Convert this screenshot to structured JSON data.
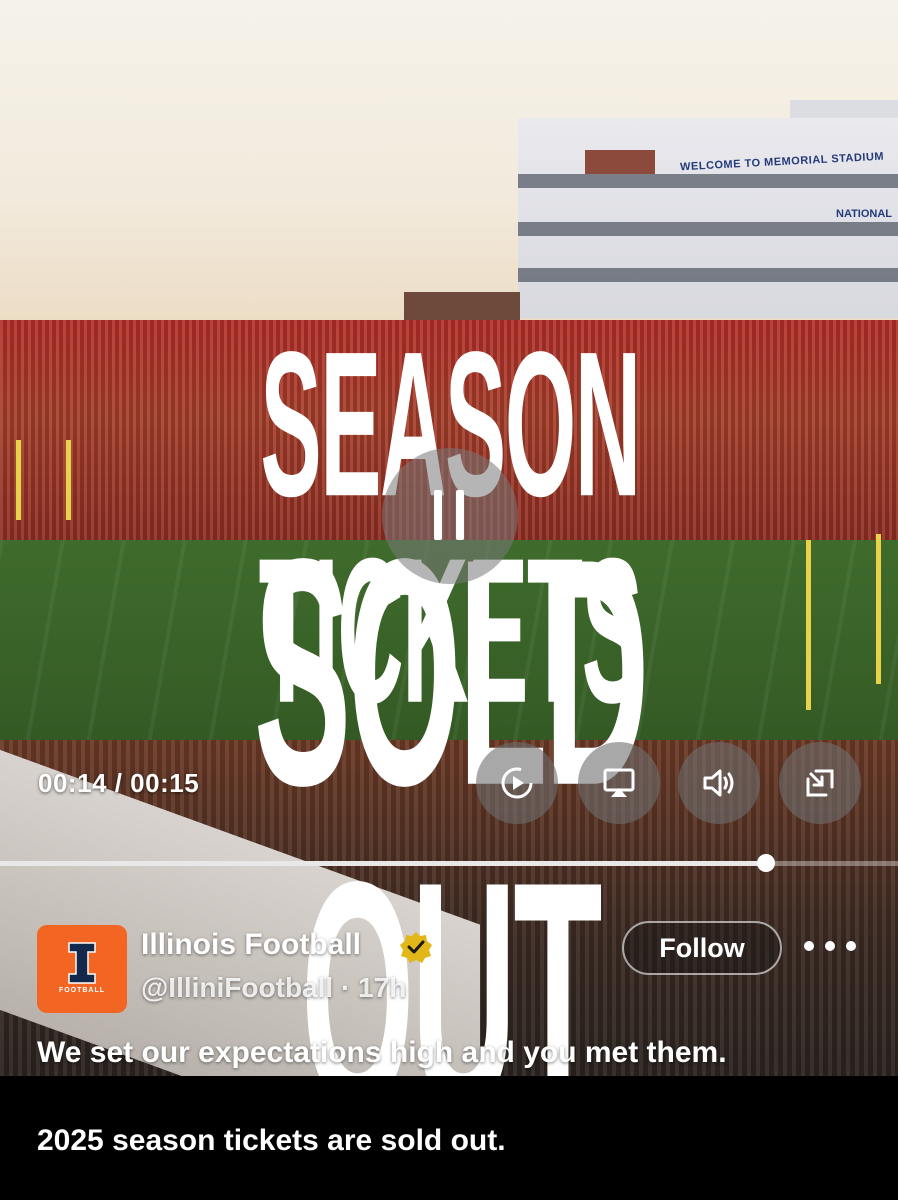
{
  "video": {
    "headline_line1": "SEASON TICKETS",
    "headline_line2": "SOLD OUT",
    "stadium_sign": "WELCOME TO MEMORIAL STADIUM",
    "stadium_sign_2": "NATIONAL",
    "time": "00:14 / 00:15",
    "progress": 0.853,
    "controls": {
      "pause_icon": "pause-icon",
      "replay_icon": "replay-icon",
      "airplay_icon": "airplay-icon",
      "volume_icon": "volume-icon",
      "minimize_icon": "minimize-icon"
    }
  },
  "post": {
    "avatar_caption": "FOOTBALL",
    "display_name": "Illinois Football",
    "handle_line": "@IlliniFootball · 17h",
    "follow_label": "Follow",
    "text_line1": "We set our expectations high and you met them.",
    "text_line2": "2025 season tickets are sold out.",
    "colors": {
      "brand_orange": "#F26522",
      "brand_navy": "#13294B",
      "verified_gold": "#E2B719"
    }
  }
}
